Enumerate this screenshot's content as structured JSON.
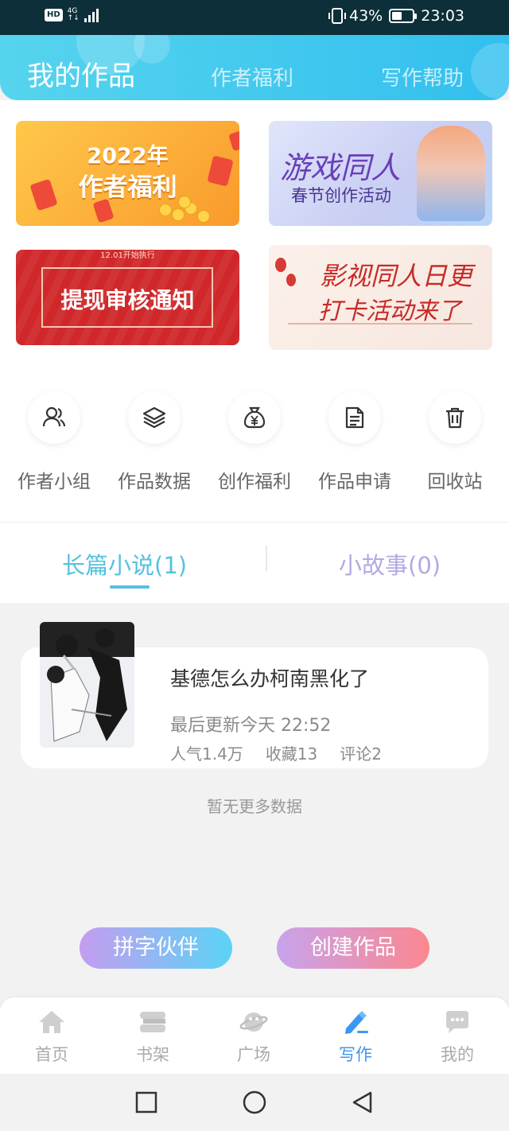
{
  "status_bar": {
    "hd": "HD",
    "network_top": "4G",
    "network_bottom": "↑↓",
    "battery": "43%",
    "time": "23:03"
  },
  "header": {
    "tabs": [
      {
        "label": "我的作品",
        "active": true
      },
      {
        "label": "作者福利",
        "active": false
      },
      {
        "label": "写作帮助",
        "active": false
      }
    ]
  },
  "banners": [
    {
      "name": "author-welfare-2022",
      "line1": "2022年",
      "line2": "作者福利"
    },
    {
      "name": "game-fanfic-event",
      "line1": "游戏同人",
      "line2": "春节创作活动"
    },
    {
      "name": "withdraw-review-notice",
      "small": "12.01开始执行",
      "line1": "提现审核通知"
    },
    {
      "name": "film-fanfic-event",
      "line1": "影视同人日更",
      "line2": "打卡活动来了"
    }
  ],
  "quick_actions": [
    {
      "label": "作者小组",
      "icon": "group-icon"
    },
    {
      "label": "作品数据",
      "icon": "layers-icon"
    },
    {
      "label": "创作福利",
      "icon": "money-bag-icon"
    },
    {
      "label": "作品申请",
      "icon": "document-icon"
    },
    {
      "label": "回收站",
      "icon": "trash-icon"
    }
  ],
  "works_tabs": [
    {
      "label": "长篇小说(1)",
      "active": true
    },
    {
      "label": "小故事(0)",
      "active": false
    }
  ],
  "works": [
    {
      "title": "基德怎么办柯南黑化了",
      "updated": "最后更新今天 22:52",
      "popularity": "人气1.4万",
      "favorites": "收藏13",
      "comments": "评论2"
    }
  ],
  "empty_hint": "暂无更多数据",
  "actions": {
    "partner": "拼字伙伴",
    "create": "创建作品"
  },
  "bottom_nav": [
    {
      "label": "首页",
      "icon": "home-icon",
      "active": false
    },
    {
      "label": "书架",
      "icon": "bookshelf-icon",
      "active": false
    },
    {
      "label": "广场",
      "icon": "planet-icon",
      "active": false
    },
    {
      "label": "写作",
      "icon": "pen-icon",
      "active": true
    },
    {
      "label": "我的",
      "icon": "chat-face-icon",
      "active": false
    }
  ],
  "colors": {
    "header_start": "#56d4ee",
    "header_end": "#32bfee",
    "tab_active": "#54c2df",
    "tab_inactive": "#b2a9e2",
    "nav_active": "#3d96f0"
  }
}
